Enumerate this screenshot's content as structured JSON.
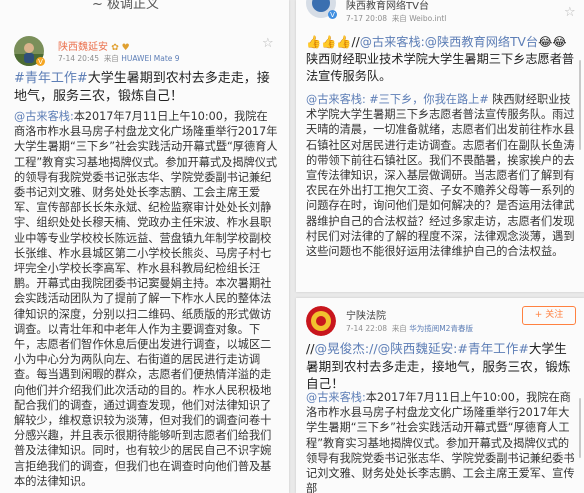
{
  "left_post": {
    "cut_header": "~ 极调正义",
    "author": "陕西魏延安",
    "author_badges": "✿ ♥",
    "time": "7-14 20:45",
    "source_prefix": "来自",
    "source": "HUAWEI Mate 9",
    "headline_tag": "#青年工作#",
    "headline": "大学生暑期到农村去多走走，接地气，服务三农，锻炼自己！",
    "body_mention": "@古来客栈:",
    "body": "本2017年7月11日上午10:00，我院在商洛市柞水县马房子村盘龙文化广场隆重举行2017年大学生暑期“三下乡”社会实践活动开幕式暨“厚德育人工程”教育实习基地揭牌仪式。参加开幕式及揭牌仪式的领导有我院党委书记张志华、学院党委副书记兼纪委书记刘文雅、财务处处长李志鹏、工会主席王爱军、宣传部部长长朱永斌、纪检监察审计处处长刘静宇、组织处处长穆天楠、党政办主任宋波、柞水县职业中等专业学校校长陈远益、营盘镇九年制学校副校长张维、柞水县城区第二小学校长熊炎、马房子村七坪完全小学校长李高军、柞水县科教局纪检组长汪鹏。开幕式由我院团委书记窦曼娟主持。本次暑期社会实践活动团队为了提前了解一下柞水人民的整体法律知识的深度，分别以扫二维码、纸质版的形式做访调查。以青壮年和中老年人作为主要调查对象。下午，志愿者们智作休息后便出发进行调查，以城区二小为中心分为两队向左、右街道的居民进行走访调查。每当遇到闲暇的群众，志愿者们便热情洋溢的走向他们并介绍我们此次活动的目的。柞水人民积极地配合我们的调查，通过调查发现，他们对法律知识了解较少，维权意识较为淡薄，但对我们的调查问卷十分感兴趣，并且表示很期待能够听到志愿者们给我们普及法律知识。同时，也有较少的居民自己不识字婉言拒绝我们的调查，但我们也在调查时向他们普及基本的法律知识。"
  },
  "right_top_post": {
    "author": "陕西教育网络TV台",
    "time": "7-17 20:08",
    "source_prefix": "来自",
    "source": "Weibo.intl",
    "emoji_lead": "👍👍👍//",
    "forward_chain": "@古来客栈:@陕西教育网络TV台",
    "emoji_tail": "😂😂",
    "forward_text": "陕西财经职业技术学院大学生暑期三下乡志愿者普法宣传服务队。",
    "orig_mention": "@古来客栈:",
    "orig_tag": "#三下乡，你我在路上#",
    "orig_text": "陕西财经职业技术学院大学生暑期三下乡志愿者普法宣传服务队。雨过天晴的清晨，一切准备就绪，志愿者们出发前往柞水县石镇社区对居民进行走访调查。志愿者们在副队长鱼涛的带领下前往石镇社区。我们不畏酷暑，挨家挨户的去宣传法律知识，深入基层做调研。当志愿者们了解到有农民在外出打工抱欠工资、子女不赡养父母等一系列的问题存在时，询问他们是如何解决的？是否运用法律武器维护自己的合法权益？经过多家走访，志愿者们发现村民们对法律的了解的程度不深，法律观念淡薄，遇到这些问题也不能很好运用法律维护自己的合法权益。"
  },
  "right_bottom_post": {
    "author": "宁陕法院",
    "follow_label": "+ 关注",
    "time": "7-14 22:08",
    "source_prefix": "来自",
    "source": "华为揽阅M2青春版",
    "forward_prefix": "//",
    "forward_mention": "@晃俊杰:",
    "forward_chain": "//@陕西魏延安:",
    "forward_tag": "#青年工作#",
    "forward_text": "大学生暑期到农村去多走走，接地气，服务三农，锻炼自己！",
    "orig_mention": "@古来客栈:",
    "orig_text": "本2017年7月11日上午10:00，我院在商洛市柞水县马房子村盘龙文化广场隆重举行2017年大学生暑期“三下乡”社会实践活动开幕式暨“厚德育人工程”教育实习基地揭牌仪式。参加开幕式及揭牌仪式的领导有我院党委书记张志华、学院党委副书记兼纪委书记刘文雅、财务处处长李志鹏、工会主席王爱军、宣传部"
  },
  "colors": {
    "username": "#eb7350",
    "link": "#5d7eb6",
    "follow": "#ff8140",
    "meta": "#8e8e8e"
  },
  "icons": [
    "avatar-photo",
    "weibo-v-badge",
    "court-emblem-avatar",
    "favorite-star-icon",
    "scrollbar"
  ]
}
